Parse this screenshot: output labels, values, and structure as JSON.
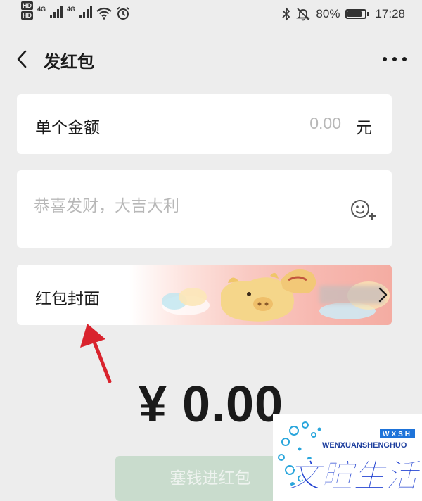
{
  "status_bar": {
    "hd1": "HD",
    "hd2": "HD",
    "net1": "4G",
    "net2": "4G",
    "battery_level": 0.8,
    "battery_text": "80%",
    "time": "17:28"
  },
  "header": {
    "title": "发红包"
  },
  "amount": {
    "label": "单个金额",
    "value": "0.00",
    "unit": "元"
  },
  "message": {
    "placeholder": "恭喜发财，大吉大利"
  },
  "cover": {
    "label": "红包封面"
  },
  "total": {
    "text": "¥ 0.00"
  },
  "send_button": {
    "label": "塞钱进红包"
  },
  "watermark": {
    "latin": "WENXUANSHENGHUO",
    "badge": "WXSH",
    "chinese": "文暄生活"
  },
  "colors": {
    "accent_red": "#d9232d",
    "button_disabled": "#c9dccd",
    "background": "#ededed"
  }
}
